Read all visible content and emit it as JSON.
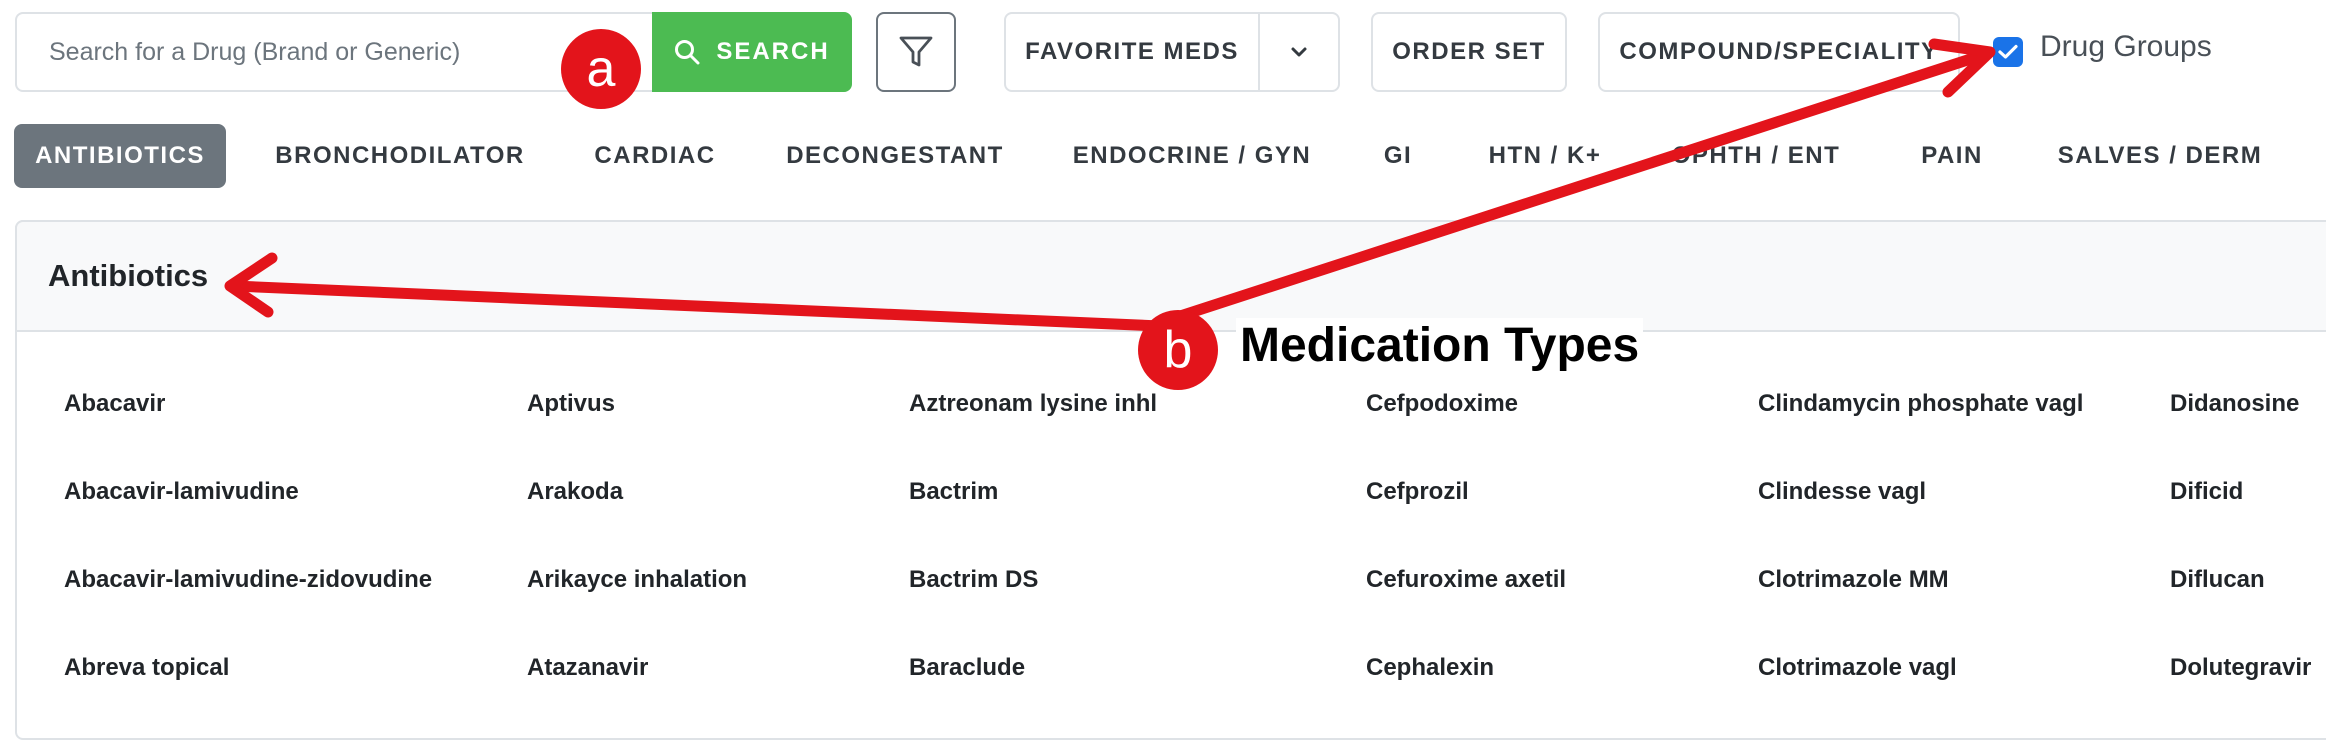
{
  "toolbar": {
    "search_placeholder": "Search for a Drug (Brand or Generic)",
    "search_label": "SEARCH",
    "favorite_label": "FAVORITE MEDS",
    "order_set_label": "ORDER SET",
    "compound_label": "COMPOUND/SPECIALITY",
    "drug_groups_label": "Drug Groups",
    "drug_groups_checked": true
  },
  "tabs": [
    {
      "label": "ANTIBIOTICS",
      "active": true
    },
    {
      "label": "BRONCHODILATOR"
    },
    {
      "label": "CARDIAC"
    },
    {
      "label": "DECONGESTANT"
    },
    {
      "label": "ENDOCRINE / GYN"
    },
    {
      "label": "GI"
    },
    {
      "label": "HTN / K+"
    },
    {
      "label": "OPHTH / ENT"
    },
    {
      "label": "PAIN"
    },
    {
      "label": "SALVES / DERM"
    }
  ],
  "section": {
    "title": "Antibiotics"
  },
  "drugs": {
    "col1": [
      "Abacavir",
      "Abacavir-lamivudine",
      "Abacavir-lamivudine-zidovudine",
      "Abreva topical"
    ],
    "col2": [
      "Aptivus",
      "Arakoda",
      "Arikayce inhalation",
      "Atazanavir"
    ],
    "col3": [
      "Aztreonam lysine inhl",
      "Bactrim",
      "Bactrim DS",
      "Baraclude"
    ],
    "col4": [
      "Cefpodoxime",
      "Cefprozil",
      "Cefuroxime axetil",
      "Cephalexin"
    ],
    "col5": [
      "Clindamycin phosphate vagl",
      "Clindesse vagl",
      "Clotrimazole MM",
      "Clotrimazole vagl"
    ],
    "col6": [
      "Didanosine",
      "Dificid",
      "Diflucan",
      "Dolutegravir"
    ]
  },
  "annotations": {
    "marker_a": "a",
    "marker_b": "b",
    "caption_b": "Medication Types",
    "color": "#e3141b"
  },
  "colors": {
    "search_green": "#4cbb52",
    "active_tab": "#6c757d",
    "checkbox_blue": "#1a73e8"
  }
}
